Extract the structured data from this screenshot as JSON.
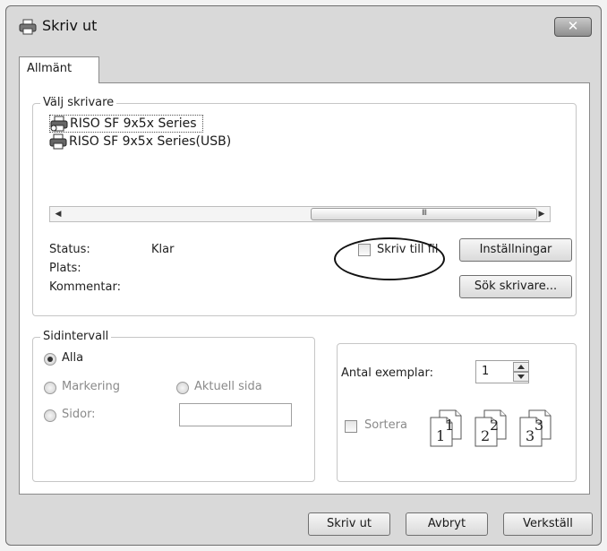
{
  "window": {
    "title": "Skriv ut",
    "close_glyph": "✕"
  },
  "tabs": [
    {
      "label": "Allmänt"
    }
  ],
  "printer_group": {
    "label": "Välj skrivare",
    "printers": [
      {
        "name": "RISO SF 9x5x Series",
        "selected": true
      },
      {
        "name": "RISO SF 9x5x Series(USB)",
        "selected": false
      }
    ],
    "scroll_thumb_glyph": "III",
    "status_label": "Status:",
    "status_value": "Klar",
    "location_label": "Plats:",
    "comment_label": "Kommentar:",
    "print_to_file_label": "Skriv till fil",
    "print_to_file_checked": false,
    "preferences_button": "Inställningar",
    "find_printer_button": "Sök skrivare..."
  },
  "page_range": {
    "label": "Sidintervall",
    "all_label": "Alla",
    "selection_label": "Markering",
    "current_page_label": "Aktuell sida",
    "pages_label": "Sidor:",
    "pages_value": "",
    "selected": "all"
  },
  "copies": {
    "count_label": "Antal exemplar:",
    "count_value": "1",
    "collate_label": "Sortera",
    "collate_checked": false,
    "collate_pages": [
      "1",
      "1",
      "2",
      "2",
      "3",
      "3"
    ]
  },
  "buttons": {
    "print": "Skriv ut",
    "cancel": "Avbryt",
    "apply": "Verkställ"
  },
  "icons": [
    "printer-icon",
    "close-icon",
    "scroll-left-icon",
    "scroll-right-icon",
    "spinner-up-icon",
    "spinner-down-icon",
    "collate-pages-icon"
  ]
}
